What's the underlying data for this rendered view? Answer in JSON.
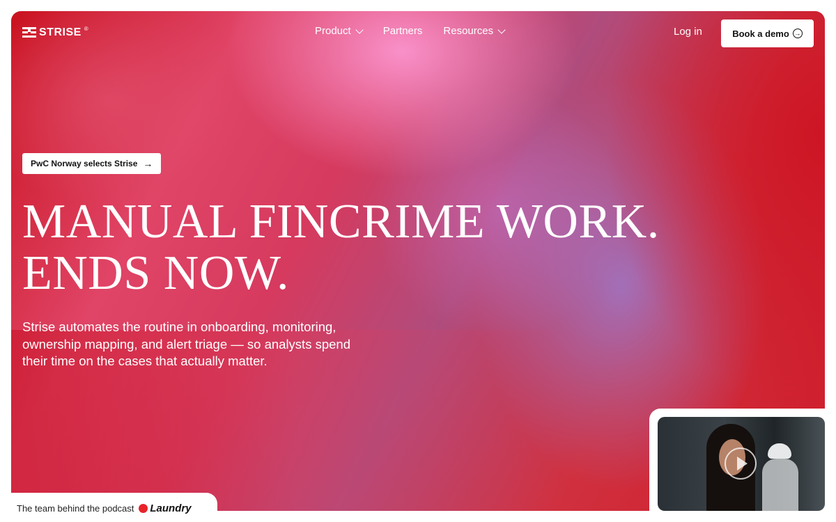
{
  "header": {
    "logo_text": "STRISE",
    "logo_reg": "®",
    "nav": [
      {
        "label": "Product",
        "has_dropdown": true
      },
      {
        "label": "Partners",
        "has_dropdown": false
      },
      {
        "label": "Resources",
        "has_dropdown": true
      }
    ],
    "login_label": "Log in",
    "demo_label": "Book a demo"
  },
  "announcement": {
    "label": "PwC Norway selects Strise",
    "icon": "arrow-right-icon"
  },
  "hero": {
    "headline_line1": "MANUAL FINCRIME WORK.",
    "headline_line2": "ENDS NOW.",
    "subtitle": "Strise automates the routine in onboarding, monitoring, ownership mapping, and alert triage — so analysts spend their time on the cases that actually matter."
  },
  "podcast": {
    "label": "The team behind the podcast",
    "brand": "Laundry"
  },
  "video": {
    "icon": "play-icon"
  },
  "colors": {
    "red": "#cf1b2a",
    "pink": "#ff9fd8",
    "purple": "#9a82dc",
    "text_on_hero": "#ffffff",
    "button_bg": "#ffffff"
  }
}
